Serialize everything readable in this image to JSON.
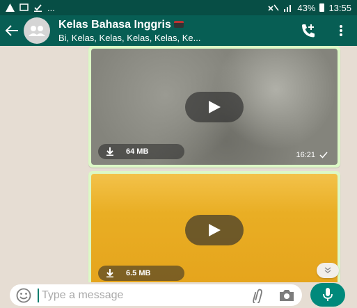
{
  "status_bar": {
    "left_icons": [
      "warning-icon",
      "cast-icon",
      "download-done-icon"
    ],
    "dots": "...",
    "battery": "43%",
    "time": "13:55"
  },
  "header": {
    "title": "Kelas Bahasa Inggris",
    "subtitle": "Bi, Kelas, Kelas, Kelas, Kelas, Ke..."
  },
  "messages": [
    {
      "file_size": "64 MB",
      "time": "16:21"
    },
    {
      "file_size": "6.5 MB",
      "time": ""
    }
  ],
  "input": {
    "placeholder": "Type a message"
  },
  "colors": {
    "status_bar": "#074e45",
    "app_bar": "#075e54",
    "chat_bg": "#e6ddd3",
    "outgoing_bubble": "#dcf8c6",
    "mic_button": "#00897b"
  }
}
